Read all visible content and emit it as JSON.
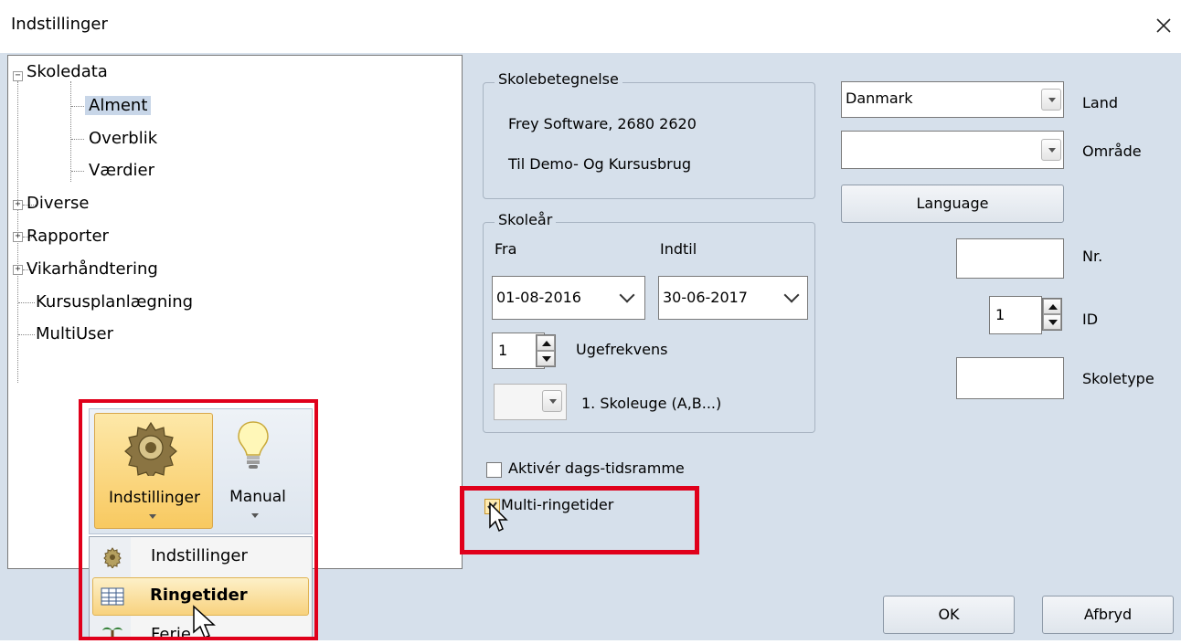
{
  "window": {
    "title": "Indstillinger"
  },
  "tree": {
    "root": "Skoledata",
    "children": [
      "Alment",
      "Overblik",
      "Værdier"
    ],
    "others": [
      "Diverse",
      "Rapporter",
      "Vikarhåndtering",
      "Kursusplanlægning",
      "MultiUser"
    ],
    "selected": "Alment"
  },
  "school": {
    "group_label": "Skolebetegnelse",
    "line1": "Frey Software, 2680 2620",
    "line2": "Til Demo- Og Kursusbrug"
  },
  "year": {
    "group_label": "Skoleår",
    "from_label": "Fra",
    "to_label": "Indtil",
    "from_value": "01-08-2016",
    "to_value": "30-06-2017",
    "week_freq_value": "1",
    "week_freq_label": "Ugefrekvens",
    "first_week_label": "1. Skoleuge (A,B...)"
  },
  "right": {
    "country_value": "Danmark",
    "country_label": "Land",
    "area_label": "Område",
    "language_button": "Language",
    "nr_label": "Nr.",
    "id_value": "1",
    "id_label": "ID",
    "school_type_label": "Skoletype"
  },
  "checks": {
    "day_frame": "Aktivér dags-tidsramme",
    "multi_bells": "Multi-ringetider"
  },
  "buttons": {
    "ok": "OK",
    "cancel": "Afbryd"
  },
  "ribbon": {
    "settings_label": "Indstillinger",
    "manual_label": "Manual",
    "menu_items": [
      "Indstillinger",
      "Ringetider",
      "Ferie"
    ]
  },
  "colors": {
    "client_bg": "#d6e0eb",
    "highlight_red": "#e0001b",
    "ribbon_gold": "#f8c960"
  }
}
